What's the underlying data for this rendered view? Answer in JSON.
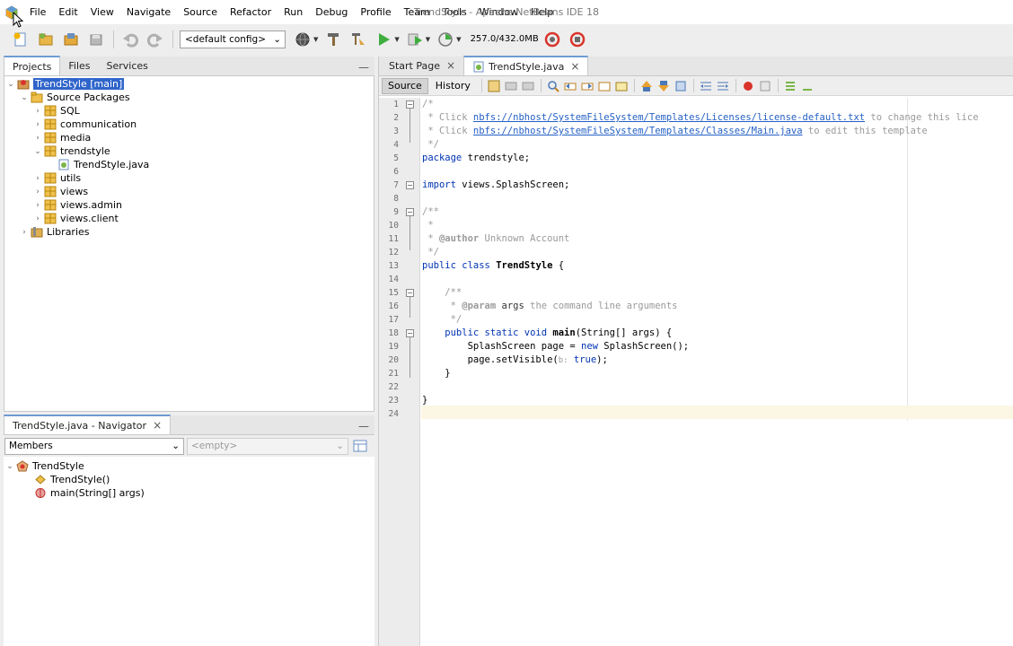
{
  "window": {
    "title": "TrendStyle - Apache NetBeans IDE 18"
  },
  "menu": [
    "File",
    "Edit",
    "View",
    "Navigate",
    "Source",
    "Refactor",
    "Run",
    "Debug",
    "Profile",
    "Team",
    "Tools",
    "Window",
    "Help"
  ],
  "toolbar": {
    "config": "<default config>",
    "memory": "257.0/432.0MB"
  },
  "projects_panel": {
    "tabs": [
      "Projects",
      "Files",
      "Services"
    ],
    "tree": {
      "project": "TrendStyle [main]",
      "source_packages": "Source Packages",
      "packages": [
        "SQL",
        "communication",
        "media",
        "trendstyle",
        "utils",
        "views",
        "views.admin",
        "views.client"
      ],
      "file": "TrendStyle.java",
      "libraries": "Libraries"
    }
  },
  "navigator": {
    "title": "TrendStyle.java - Navigator",
    "filter": "Members",
    "secondary": "<empty>",
    "root": "TrendStyle",
    "members": [
      "TrendStyle()",
      "main(String[] args)"
    ]
  },
  "editor": {
    "tabs": [
      "Start Page",
      "TrendStyle.java"
    ],
    "modes": [
      "Source",
      "History"
    ],
    "line_numbers": [
      "1",
      "2",
      "3",
      "4",
      "5",
      "6",
      "7",
      "8",
      "9",
      "10",
      "11",
      "12",
      "13",
      "14",
      "15",
      "16",
      "17",
      "18",
      "19",
      "20",
      "21",
      "22",
      "23",
      "24"
    ],
    "code": {
      "l1": "/*",
      "l2_pre": " * Click ",
      "l2_link": "nbfs://nbhost/SystemFileSystem/Templates/Licenses/license-default.txt",
      "l2_post": " to change this lice",
      "l3_pre": " * Click ",
      "l3_link": "nbfs://nbhost/SystemFileSystem/Templates/Classes/Main.java",
      "l3_post": " to edit this template",
      "l4": " */",
      "l5_kw": "package",
      "l5_rest": " trendstyle;",
      "l7_kw": "import",
      "l7_rest": " views.SplashScreen;",
      "l9": "/**",
      "l10": " *",
      "l11_pre": " * ",
      "l11_tag": "@author",
      "l11_rest": " Unknown Account",
      "l12": " */",
      "l13_kw": "public class",
      "l13_cls": "TrendStyle",
      "l13_rest": " {",
      "l15": "    /**",
      "l16_pre": "     * ",
      "l16_tag": "@param",
      "l16_arg": " args",
      "l16_rest": " the command line arguments",
      "l17": "     */",
      "l18_kw": "    public static void",
      "l18_name": "main",
      "l18_rest": "(String[] args) {",
      "l19_pre": "        SplashScreen page = ",
      "l19_kw": "new",
      "l19_rest": " SplashScreen();",
      "l20_pre": "        page.setVisible(",
      "l20_hint": "b:",
      "l20_kw": " true",
      "l20_rest": ");",
      "l21": "    }",
      "l23": "}"
    }
  },
  "colors": {
    "selection": "#2f65ca",
    "keyword": "#0033b3",
    "comment": "#9a9a9a",
    "link": "#2460c4",
    "current_line": "#fbf7e4"
  }
}
